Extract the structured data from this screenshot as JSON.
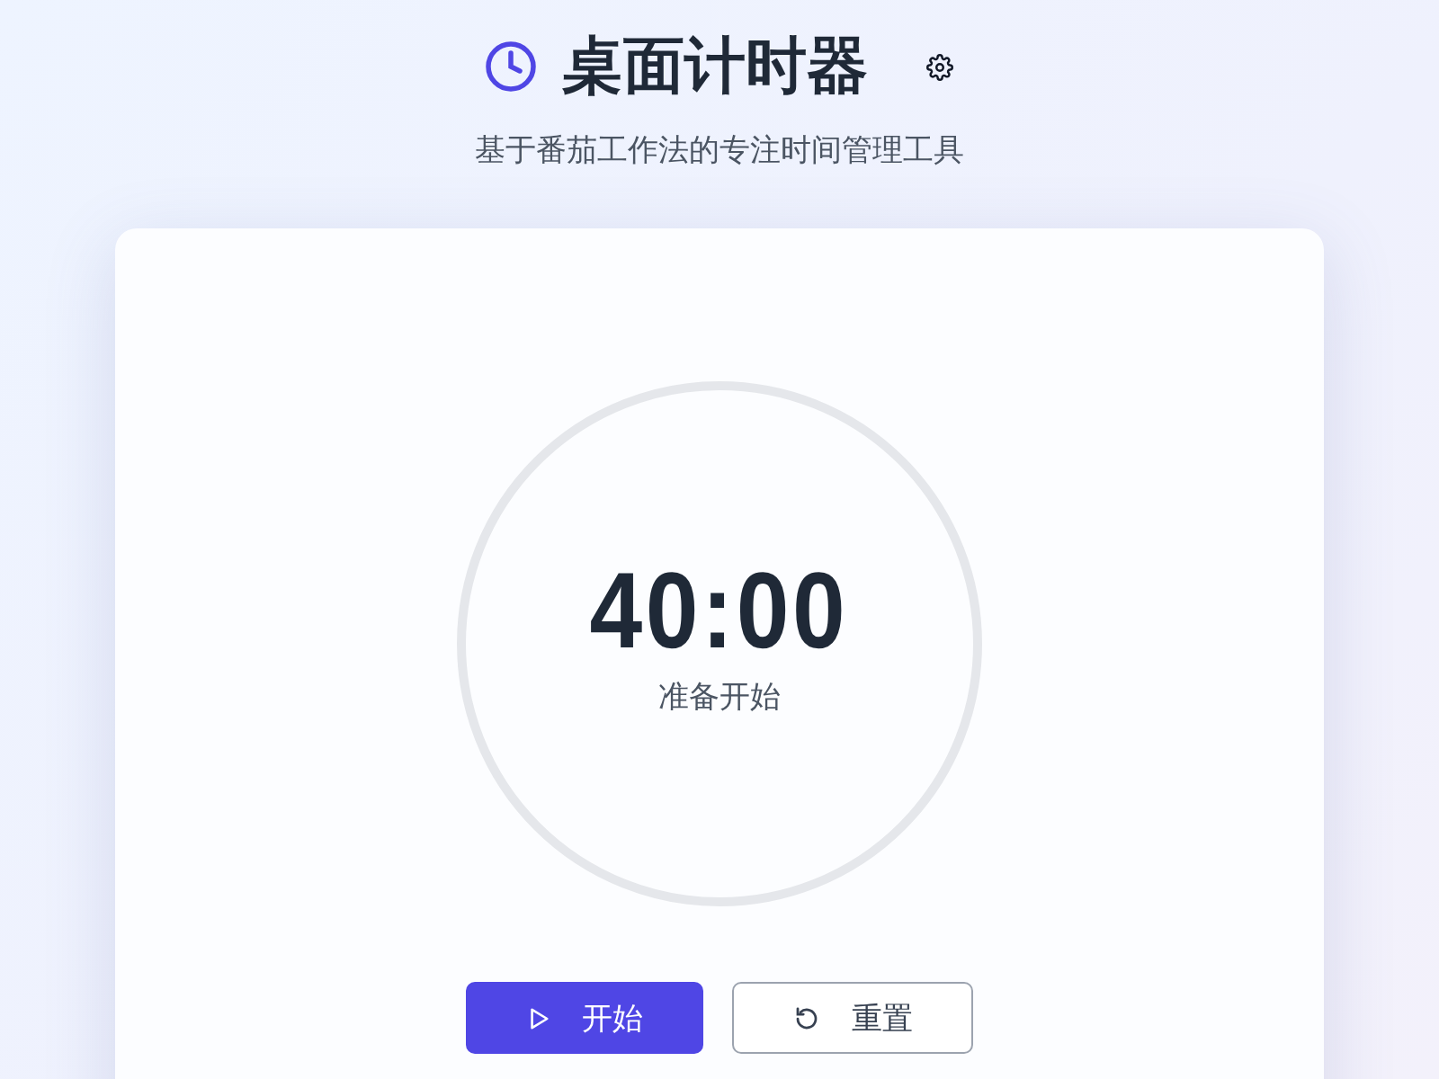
{
  "header": {
    "title": "桌面计时器",
    "subtitle": "基于番茄工作法的专注时间管理工具"
  },
  "timer": {
    "time": "40:00",
    "status": "准备开始"
  },
  "buttons": [
    {
      "kind": "start",
      "label": "开始"
    },
    {
      "kind": "reset",
      "label": "重置"
    }
  ]
}
